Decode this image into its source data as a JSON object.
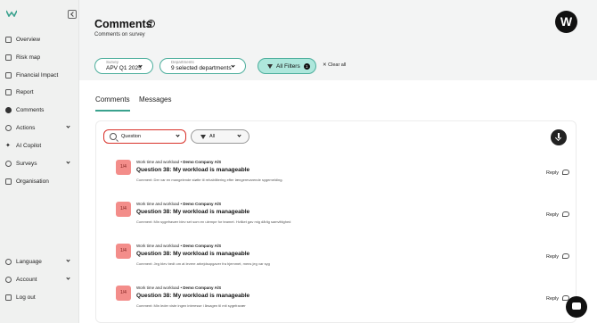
{
  "sidebar": {
    "items": [
      {
        "label": "Overview",
        "icon": "grid-icon"
      },
      {
        "label": "Risk map",
        "icon": "map-icon"
      },
      {
        "label": "Financial Impact",
        "icon": "document-icon"
      },
      {
        "label": "Report",
        "icon": "report-icon"
      },
      {
        "label": "Comments",
        "icon": "comment-icon"
      },
      {
        "label": "Actions",
        "icon": "actions-icon"
      },
      {
        "label": "AI Copilot",
        "icon": "sparkle-icon"
      },
      {
        "label": "Surveys",
        "icon": "survey-icon"
      },
      {
        "label": "Organisation",
        "icon": "organisation-icon"
      }
    ],
    "bottom": [
      {
        "label": "Language",
        "icon": "globe-icon"
      },
      {
        "label": "Account",
        "icon": "user-icon"
      },
      {
        "label": "Log out",
        "icon": "logout-icon"
      }
    ]
  },
  "header": {
    "title": "Comments",
    "subtitle": "Comments on survey",
    "brand": "W"
  },
  "filters": {
    "survey_label": "Survey",
    "survey_value": "APV Q1 2025",
    "departments_label": "Departments",
    "departments_value": "9 selected departments",
    "all_filters": "All Filters",
    "filter_count": "1",
    "clear_all": "Clear all"
  },
  "tabs": [
    "Comments",
    "Messages"
  ],
  "toolbar": {
    "question": "Question",
    "all": "All"
  },
  "comments": [
    {
      "avatar": "1/4",
      "meta_prefix": "Work time and workload",
      "company": "Demo Company A/S",
      "title": "Question 38: My workload is manageable",
      "text": "Comment: Der var en mangelende støtte til rehabilitering efter længerevarende sygemelding.",
      "reply": "Reply"
    },
    {
      "avatar": "1/4",
      "meta_prefix": "Work time and workload",
      "company": "Demo Company A/S",
      "title": "Question 38: My workload is manageable",
      "text": "Comment: Min sygefravær blev set som en ulempe for teamet. Hvilket gav mig dårlig samvittighed",
      "reply": "Reply"
    },
    {
      "avatar": "1/4",
      "meta_prefix": "Work time and workload",
      "company": "Demo Company A/S",
      "title": "Question 38: My workload is manageable",
      "text": "Comment: Jeg blev bedt om at levere arbejdsopgaver fra hjemmet, mens jeg var syg",
      "reply": "Reply"
    },
    {
      "avatar": "1/4",
      "meta_prefix": "Work time and workload",
      "company": "Demo Company A/S",
      "title": "Question 38: My workload is manageable",
      "text": "Comment: Min leder viste ingen interesse i årsagen til mit sygefravær",
      "reply": "Reply"
    }
  ],
  "colors": {
    "accent": "#3aa28e",
    "filter_active": "#aee7dc",
    "avatar": "#f38d8a",
    "highlight": "#d9322b"
  }
}
